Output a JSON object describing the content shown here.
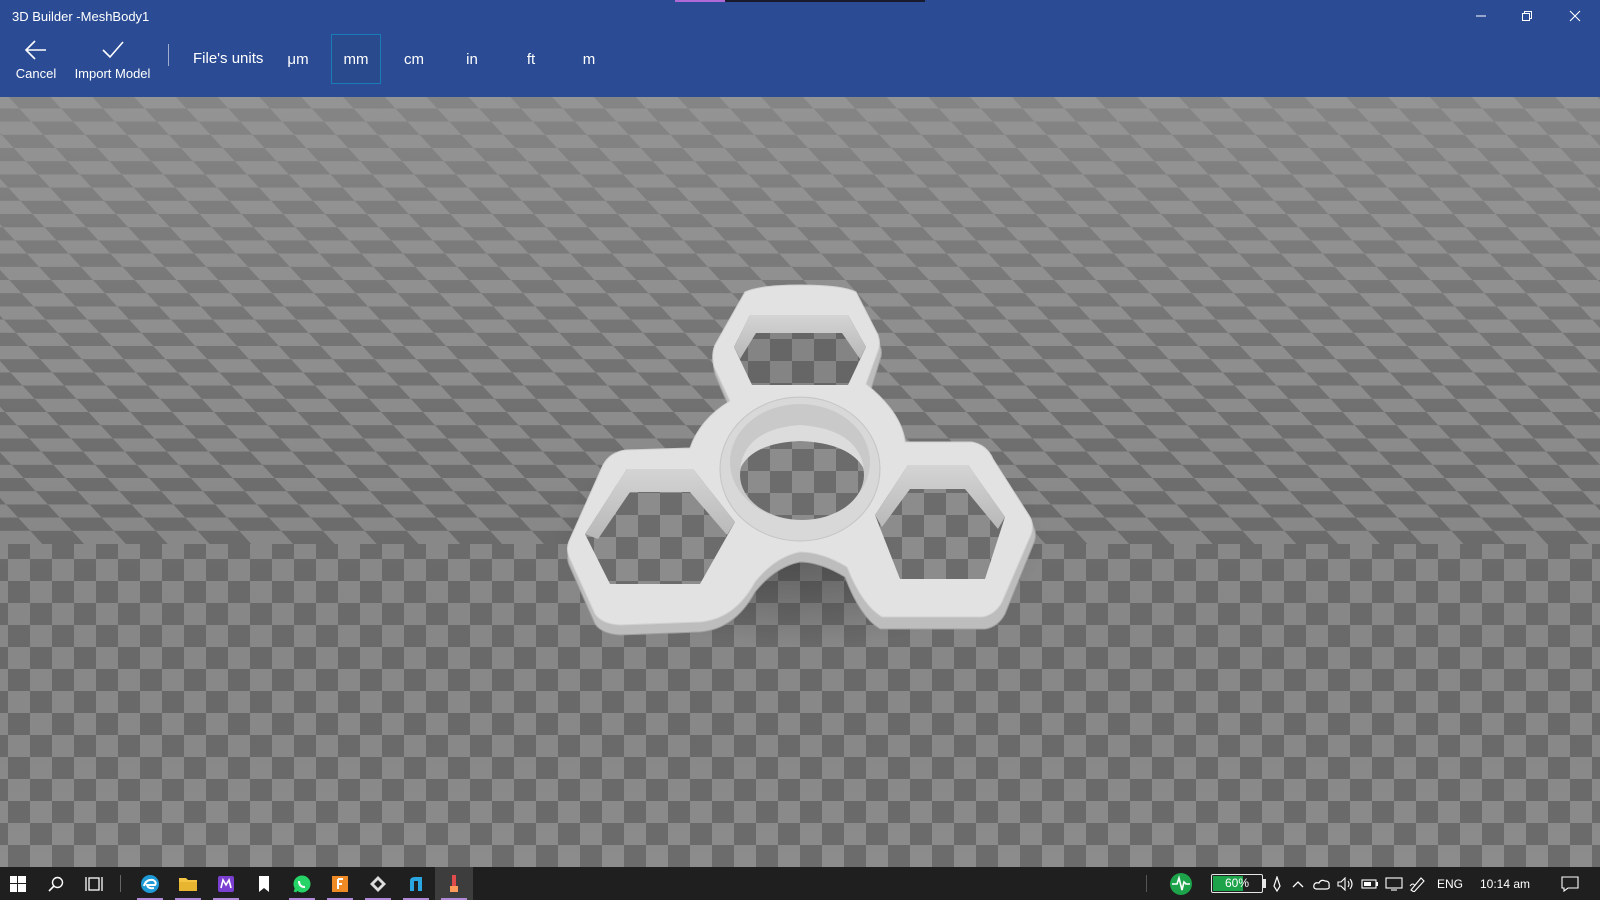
{
  "window": {
    "title": "3D Builder -MeshBody1",
    "controls": {
      "minimize": "minimize-icon",
      "restore": "restore-icon",
      "close": "close-icon"
    }
  },
  "toolbar": {
    "cancel_label": "Cancel",
    "import_label": "Import Model",
    "units_label": "File's units",
    "units": [
      "μm",
      "mm",
      "cm",
      "in",
      "ft",
      "m"
    ],
    "selected_unit": "mm"
  },
  "viewport": {
    "model_name": "MeshBody1",
    "colors": {
      "tile_light": "#8c8c8c",
      "tile_dark": "#6c6c6c",
      "model": "#e2e2e2"
    }
  },
  "taskbar": {
    "apps": [
      {
        "name": "edge-icon"
      },
      {
        "name": "file-explorer-icon"
      },
      {
        "name": "app-purple-icon"
      },
      {
        "name": "notes-icon"
      },
      {
        "name": "whatsapp-icon"
      },
      {
        "name": "app-orange-icon"
      },
      {
        "name": "app-diamond-icon"
      },
      {
        "name": "app-blue-icon"
      },
      {
        "name": "3d-builder-icon"
      }
    ],
    "battery_percent": "60%",
    "language": "ENG",
    "time": "10:14 am"
  },
  "colors": {
    "accent": "#2b4c94",
    "selection_border": "#1b7bb9",
    "taskbar": "#1f1f1f"
  }
}
